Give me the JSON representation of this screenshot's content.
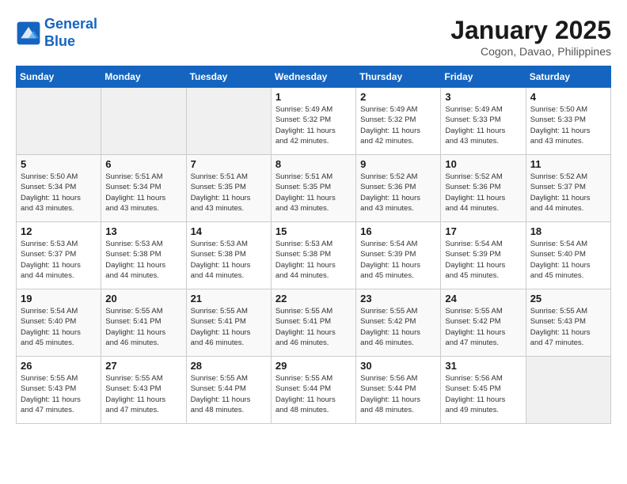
{
  "header": {
    "logo_line1": "General",
    "logo_line2": "Blue",
    "month": "January 2025",
    "location": "Cogon, Davao, Philippines"
  },
  "weekdays": [
    "Sunday",
    "Monday",
    "Tuesday",
    "Wednesday",
    "Thursday",
    "Friday",
    "Saturday"
  ],
  "weeks": [
    [
      {
        "day": "",
        "info": ""
      },
      {
        "day": "",
        "info": ""
      },
      {
        "day": "",
        "info": ""
      },
      {
        "day": "1",
        "info": "Sunrise: 5:49 AM\nSunset: 5:32 PM\nDaylight: 11 hours\nand 42 minutes."
      },
      {
        "day": "2",
        "info": "Sunrise: 5:49 AM\nSunset: 5:32 PM\nDaylight: 11 hours\nand 42 minutes."
      },
      {
        "day": "3",
        "info": "Sunrise: 5:49 AM\nSunset: 5:33 PM\nDaylight: 11 hours\nand 43 minutes."
      },
      {
        "day": "4",
        "info": "Sunrise: 5:50 AM\nSunset: 5:33 PM\nDaylight: 11 hours\nand 43 minutes."
      }
    ],
    [
      {
        "day": "5",
        "info": "Sunrise: 5:50 AM\nSunset: 5:34 PM\nDaylight: 11 hours\nand 43 minutes."
      },
      {
        "day": "6",
        "info": "Sunrise: 5:51 AM\nSunset: 5:34 PM\nDaylight: 11 hours\nand 43 minutes."
      },
      {
        "day": "7",
        "info": "Sunrise: 5:51 AM\nSunset: 5:35 PM\nDaylight: 11 hours\nand 43 minutes."
      },
      {
        "day": "8",
        "info": "Sunrise: 5:51 AM\nSunset: 5:35 PM\nDaylight: 11 hours\nand 43 minutes."
      },
      {
        "day": "9",
        "info": "Sunrise: 5:52 AM\nSunset: 5:36 PM\nDaylight: 11 hours\nand 43 minutes."
      },
      {
        "day": "10",
        "info": "Sunrise: 5:52 AM\nSunset: 5:36 PM\nDaylight: 11 hours\nand 44 minutes."
      },
      {
        "day": "11",
        "info": "Sunrise: 5:52 AM\nSunset: 5:37 PM\nDaylight: 11 hours\nand 44 minutes."
      }
    ],
    [
      {
        "day": "12",
        "info": "Sunrise: 5:53 AM\nSunset: 5:37 PM\nDaylight: 11 hours\nand 44 minutes."
      },
      {
        "day": "13",
        "info": "Sunrise: 5:53 AM\nSunset: 5:38 PM\nDaylight: 11 hours\nand 44 minutes."
      },
      {
        "day": "14",
        "info": "Sunrise: 5:53 AM\nSunset: 5:38 PM\nDaylight: 11 hours\nand 44 minutes."
      },
      {
        "day": "15",
        "info": "Sunrise: 5:53 AM\nSunset: 5:38 PM\nDaylight: 11 hours\nand 44 minutes."
      },
      {
        "day": "16",
        "info": "Sunrise: 5:54 AM\nSunset: 5:39 PM\nDaylight: 11 hours\nand 45 minutes."
      },
      {
        "day": "17",
        "info": "Sunrise: 5:54 AM\nSunset: 5:39 PM\nDaylight: 11 hours\nand 45 minutes."
      },
      {
        "day": "18",
        "info": "Sunrise: 5:54 AM\nSunset: 5:40 PM\nDaylight: 11 hours\nand 45 minutes."
      }
    ],
    [
      {
        "day": "19",
        "info": "Sunrise: 5:54 AM\nSunset: 5:40 PM\nDaylight: 11 hours\nand 45 minutes."
      },
      {
        "day": "20",
        "info": "Sunrise: 5:55 AM\nSunset: 5:41 PM\nDaylight: 11 hours\nand 46 minutes."
      },
      {
        "day": "21",
        "info": "Sunrise: 5:55 AM\nSunset: 5:41 PM\nDaylight: 11 hours\nand 46 minutes."
      },
      {
        "day": "22",
        "info": "Sunrise: 5:55 AM\nSunset: 5:41 PM\nDaylight: 11 hours\nand 46 minutes."
      },
      {
        "day": "23",
        "info": "Sunrise: 5:55 AM\nSunset: 5:42 PM\nDaylight: 11 hours\nand 46 minutes."
      },
      {
        "day": "24",
        "info": "Sunrise: 5:55 AM\nSunset: 5:42 PM\nDaylight: 11 hours\nand 47 minutes."
      },
      {
        "day": "25",
        "info": "Sunrise: 5:55 AM\nSunset: 5:43 PM\nDaylight: 11 hours\nand 47 minutes."
      }
    ],
    [
      {
        "day": "26",
        "info": "Sunrise: 5:55 AM\nSunset: 5:43 PM\nDaylight: 11 hours\nand 47 minutes."
      },
      {
        "day": "27",
        "info": "Sunrise: 5:55 AM\nSunset: 5:43 PM\nDaylight: 11 hours\nand 47 minutes."
      },
      {
        "day": "28",
        "info": "Sunrise: 5:55 AM\nSunset: 5:44 PM\nDaylight: 11 hours\nand 48 minutes."
      },
      {
        "day": "29",
        "info": "Sunrise: 5:55 AM\nSunset: 5:44 PM\nDaylight: 11 hours\nand 48 minutes."
      },
      {
        "day": "30",
        "info": "Sunrise: 5:56 AM\nSunset: 5:44 PM\nDaylight: 11 hours\nand 48 minutes."
      },
      {
        "day": "31",
        "info": "Sunrise: 5:56 AM\nSunset: 5:45 PM\nDaylight: 11 hours\nand 49 minutes."
      },
      {
        "day": "",
        "info": ""
      }
    ]
  ]
}
